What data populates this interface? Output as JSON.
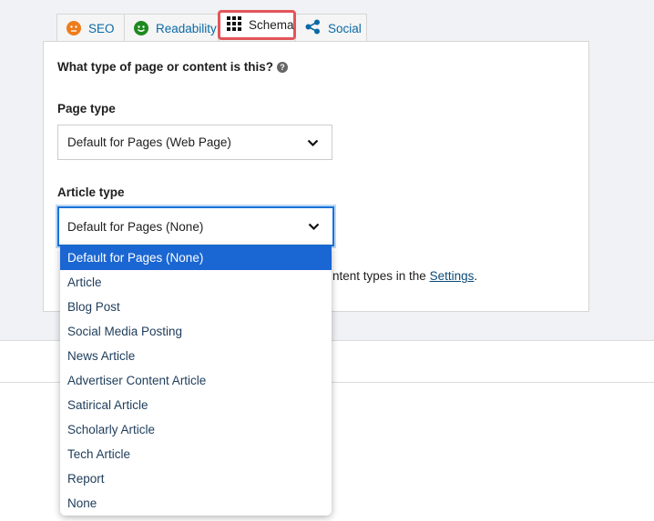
{
  "tabs": [
    {
      "label": "SEO",
      "icon": "orange-neutral-face-icon",
      "color": "#ee7c1b"
    },
    {
      "label": "Readability",
      "icon": "green-smiley-face-icon",
      "color": "#1e8a1e"
    },
    {
      "label": "Schema",
      "icon": "grid-icon"
    },
    {
      "label": "Social",
      "icon": "share-icon"
    }
  ],
  "panel": {
    "question": "What type of page or content is this?",
    "page_type_label": "Page type",
    "page_type_value": "Default for Pages (Web Page)",
    "article_type_label": "Article type",
    "article_type_value": "Default for Pages (None)",
    "hint_text": "ntent types in the ",
    "hint_link": "Settings",
    "hint_end": "."
  },
  "article_options": [
    "Default for Pages (None)",
    "Article",
    "Blog Post",
    "Social Media Posting",
    "News Article",
    "Advertiser Content Article",
    "Satirical Article",
    "Scholarly Article",
    "Tech Article",
    "Report",
    "None"
  ],
  "colors": {
    "accent": "#1a66d2",
    "focus": "#2271b1",
    "tab_highlight": "#e2555a"
  }
}
